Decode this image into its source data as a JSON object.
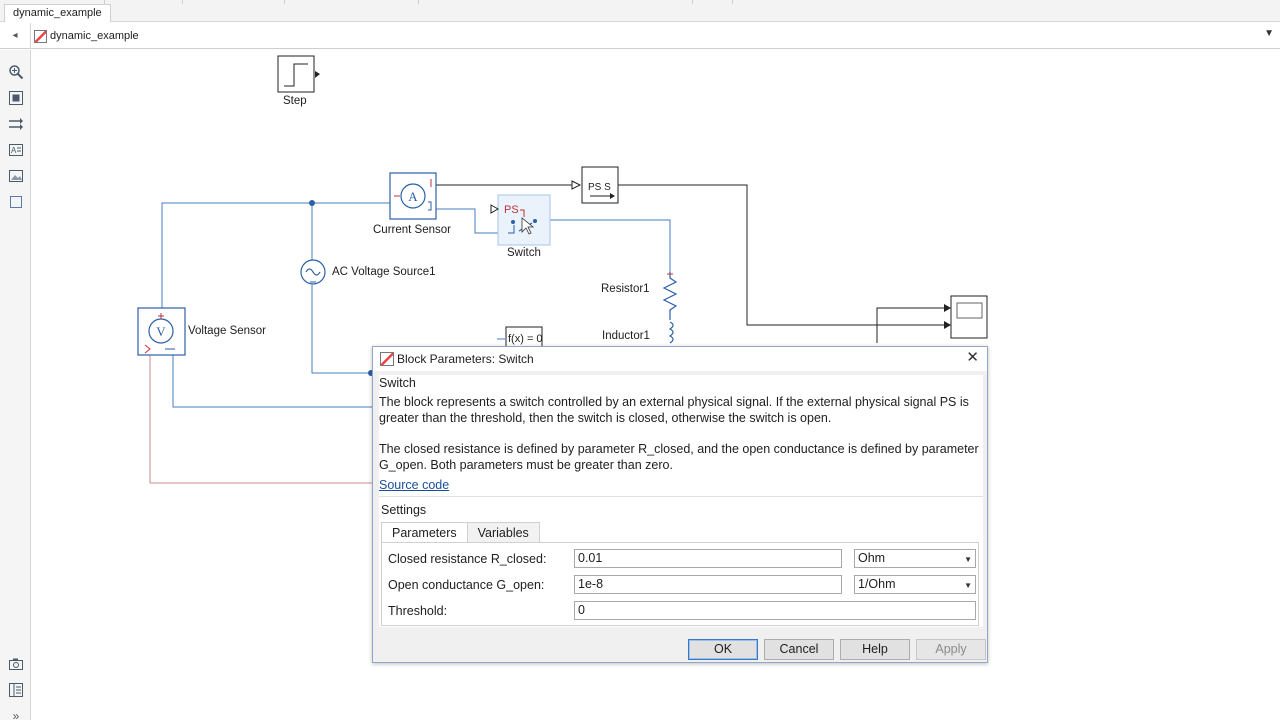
{
  "window": {
    "tab_label": "dynamic_example",
    "breadcrumb": "dynamic_example"
  },
  "left_toolbar": {
    "icons": [
      "zoom-icon",
      "fit-view-icon",
      "signal-route-icon",
      "annotation-icon",
      "image-icon",
      "area-icon",
      "camera-icon",
      "model-browser-icon",
      "expand-icon"
    ]
  },
  "diagram": {
    "blocks": {
      "step": "Step",
      "current_sensor": "Current Sensor",
      "switch": "Switch",
      "ac_voltage_source": "AC Voltage Source1",
      "voltage_sensor": "Voltage Sensor",
      "resistor": "Resistor1",
      "inductor": "Inductor1",
      "solver": "f(x) = 0",
      "ps_converter": "PS  S",
      "ps_port": "PS",
      "ammeter_glyph": "A",
      "voltmeter_glyph": "V"
    },
    "colors": {
      "wire": "#4a7cc0",
      "signal_red": "#c0303a",
      "block_border": "#2b5fa8"
    }
  },
  "dialog": {
    "title": "Block Parameters: Switch",
    "block_name": "Switch",
    "description_1": "The block represents a switch controlled by an external physical signal. If the external physical signal PS is greater than the threshold, then the switch is closed, otherwise the switch is open.",
    "description_2": "The closed resistance is defined by parameter R_closed, and the open conductance is defined by parameter G_open. Both parameters must be greater than zero.",
    "source_link": "Source code",
    "settings_label": "Settings",
    "tabs": [
      "Parameters",
      "Variables"
    ],
    "params": [
      {
        "label": "Closed resistance R_closed:",
        "value": "0.01",
        "unit": "Ohm"
      },
      {
        "label": "Open conductance G_open:",
        "value": "1e-8",
        "unit": "1/Ohm"
      },
      {
        "label": "Threshold:",
        "value": "0"
      }
    ],
    "buttons": {
      "ok": "OK",
      "cancel": "Cancel",
      "help": "Help",
      "apply": "Apply"
    }
  }
}
